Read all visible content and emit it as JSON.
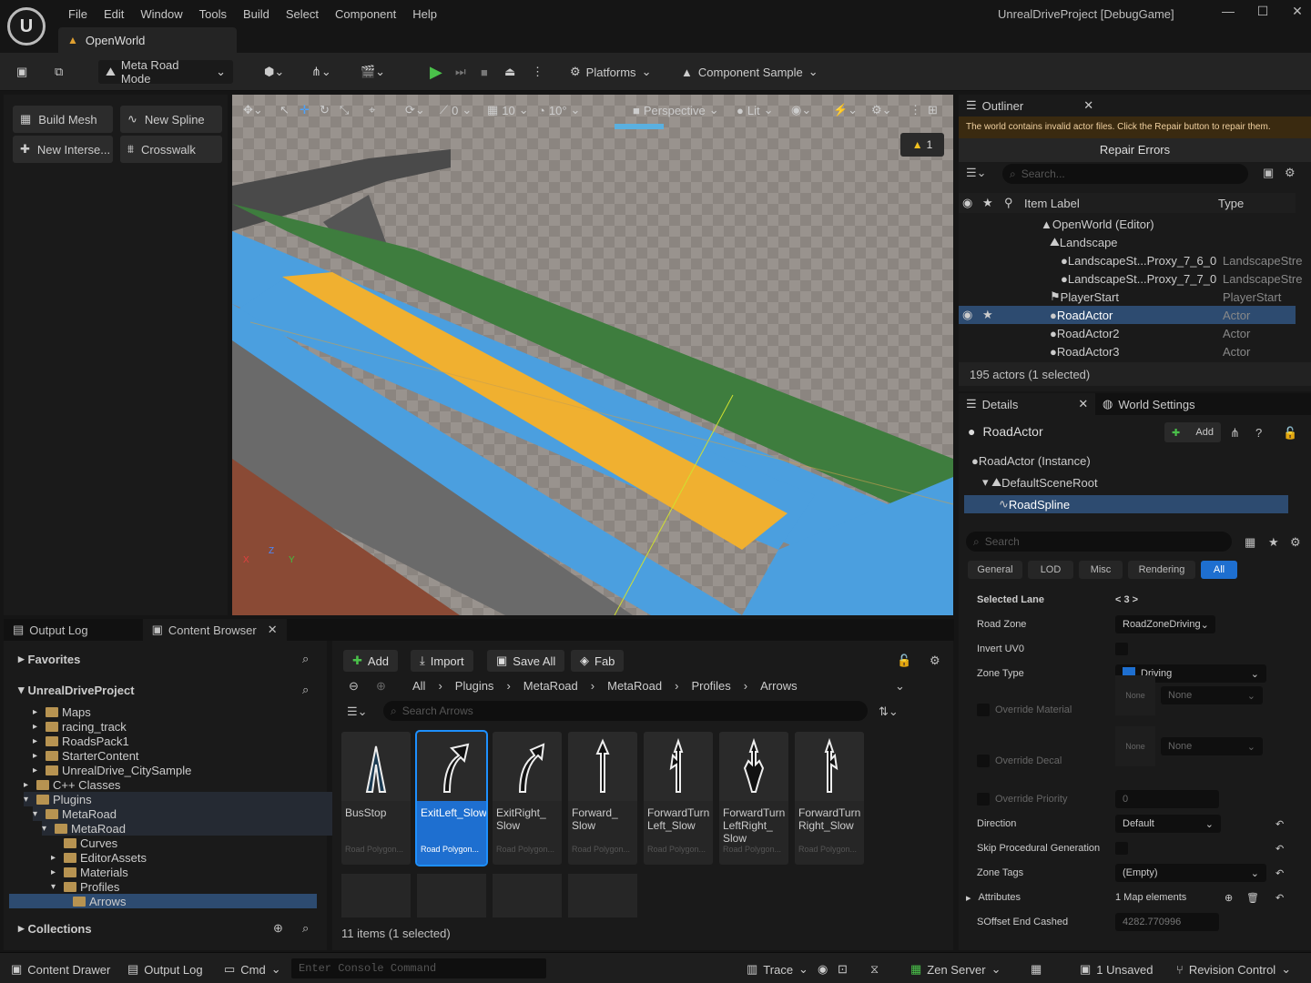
{
  "app": {
    "logo": "U",
    "menu": [
      "File",
      "Edit",
      "Window",
      "Tools",
      "Build",
      "Select",
      "Component",
      "Help"
    ],
    "window_title": "UnrealDriveProject [DebugGame]",
    "map_tab": "OpenWorld",
    "window_controls": [
      "—",
      "☐",
      "✕"
    ]
  },
  "toolbar": {
    "mode": "Meta Road Mode",
    "platforms": "Platforms",
    "component_sample": "Component Sample"
  },
  "modes_panel": {
    "buttons": [
      "Build Mesh",
      "New Spline",
      "New Interse...",
      "Crosswalk"
    ]
  },
  "viewport": {
    "perspective": "Perspective",
    "lit": "Lit",
    "angle": "0",
    "grid": "10",
    "rot": "10°",
    "warn_count": "1",
    "axes": [
      "X",
      "Z",
      "Y"
    ]
  },
  "outliner": {
    "title": "Outliner",
    "warning": "The world contains invalid actor files. Click the Repair button to repair them.",
    "repair": "Repair Errors",
    "search_placeholder": "Search...",
    "col_label": "Item Label",
    "col_type": "Type",
    "rows": [
      {
        "label": "OpenWorld (Editor)",
        "type": ""
      },
      {
        "label": "Landscape",
        "type": ""
      },
      {
        "label": "LandscapeSt...Proxy_7_6_0",
        "type": "LandscapeStre"
      },
      {
        "label": "LandscapeSt...Proxy_7_7_0",
        "type": "LandscapeStre"
      },
      {
        "label": "PlayerStart",
        "type": "PlayerStart"
      },
      {
        "label": "RoadActor",
        "type": "Actor"
      },
      {
        "label": "RoadActor2",
        "type": "Actor"
      },
      {
        "label": "RoadActor3",
        "type": "Actor"
      }
    ],
    "count": "195 actors (1 selected)"
  },
  "details": {
    "tab_details": "Details",
    "tab_world": "World Settings",
    "actor": "RoadActor",
    "add": "Add",
    "components": [
      "RoadActor (Instance)",
      "DefaultSceneRoot",
      "RoadSpline"
    ],
    "search_placeholder": "Search",
    "categories": [
      "General",
      "LOD",
      "Misc",
      "Rendering",
      "All"
    ],
    "selected_lane_label": "Selected Lane",
    "selected_lane_value": "< 3 >",
    "road_zone_label": "Road Zone",
    "road_zone_value": "RoadZoneDriving",
    "invert_uv_label": "Invert UV0",
    "zone_type_label": "Zone Type",
    "zone_type_value": "Driving",
    "override_material_label": "Override Material",
    "override_decal_label": "Override Decal",
    "none": "None",
    "override_priority_label": "Override Priority",
    "override_priority_value": "0",
    "direction_label": "Direction",
    "direction_value": "Default",
    "skip_label": "Skip Procedural Generation",
    "zone_tags_label": "Zone Tags",
    "zone_tags_value": "(Empty)",
    "attributes_label": "Attributes",
    "attributes_value": "1 Map elements",
    "soffset_label": "SOffset End Cashed",
    "soffset_value": "4282.770996"
  },
  "bottom_tabs": {
    "output_log": "Output Log",
    "content_browser": "Content Browser"
  },
  "sources": {
    "favorites": "Favorites",
    "project": "UnrealDriveProject",
    "tree": [
      {
        "label": "Maps",
        "indent": 1
      },
      {
        "label": "racing_track",
        "indent": 1
      },
      {
        "label": "RoadsPack1",
        "indent": 1
      },
      {
        "label": "StarterContent",
        "indent": 1
      },
      {
        "label": "UnrealDrive_CitySample",
        "indent": 1
      },
      {
        "label": "C++ Classes",
        "indent": 0
      },
      {
        "label": "Plugins",
        "indent": 0
      },
      {
        "label": "MetaRoad",
        "indent": 1
      },
      {
        "label": "MetaRoad",
        "indent": 2
      },
      {
        "label": "Curves",
        "indent": 3
      },
      {
        "label": "EditorAssets",
        "indent": 3
      },
      {
        "label": "Materials",
        "indent": 3
      },
      {
        "label": "Profiles",
        "indent": 3
      },
      {
        "label": "Arrows",
        "indent": 4
      }
    ],
    "collections": "Collections"
  },
  "content": {
    "add": "Add",
    "import": "Import",
    "save_all": "Save All",
    "fab": "Fab",
    "crumbs": [
      "All",
      "Plugins",
      "MetaRoad",
      "MetaRoad",
      "Profiles",
      "Arrows"
    ],
    "search_placeholder": "Search Arrows",
    "assets": [
      {
        "name": "BusStop",
        "type": "Road Polygon..."
      },
      {
        "name": "ExitLeft_Slow",
        "type": "Road Polygon..."
      },
      {
        "name": "ExitRight_ Slow",
        "type": "Road Polygon..."
      },
      {
        "name": "Forward_ Slow",
        "type": "Road Polygon..."
      },
      {
        "name": "ForwardTurn Left_Slow",
        "type": "Road Polygon..."
      },
      {
        "name": "ForwardTurn LeftRight_ Slow",
        "type": "Road Polygon..."
      },
      {
        "name": "ForwardTurn Right_Slow",
        "type": "Road Polygon..."
      }
    ],
    "count": "11 items (1 selected)"
  },
  "statusbar": {
    "content_drawer": "Content Drawer",
    "output_log": "Output Log",
    "cmd": "Cmd",
    "console_placeholder": "Enter Console Command",
    "trace": "Trace",
    "zen": "Zen Server",
    "unsaved": "1 Unsaved",
    "revision": "Revision Control"
  }
}
